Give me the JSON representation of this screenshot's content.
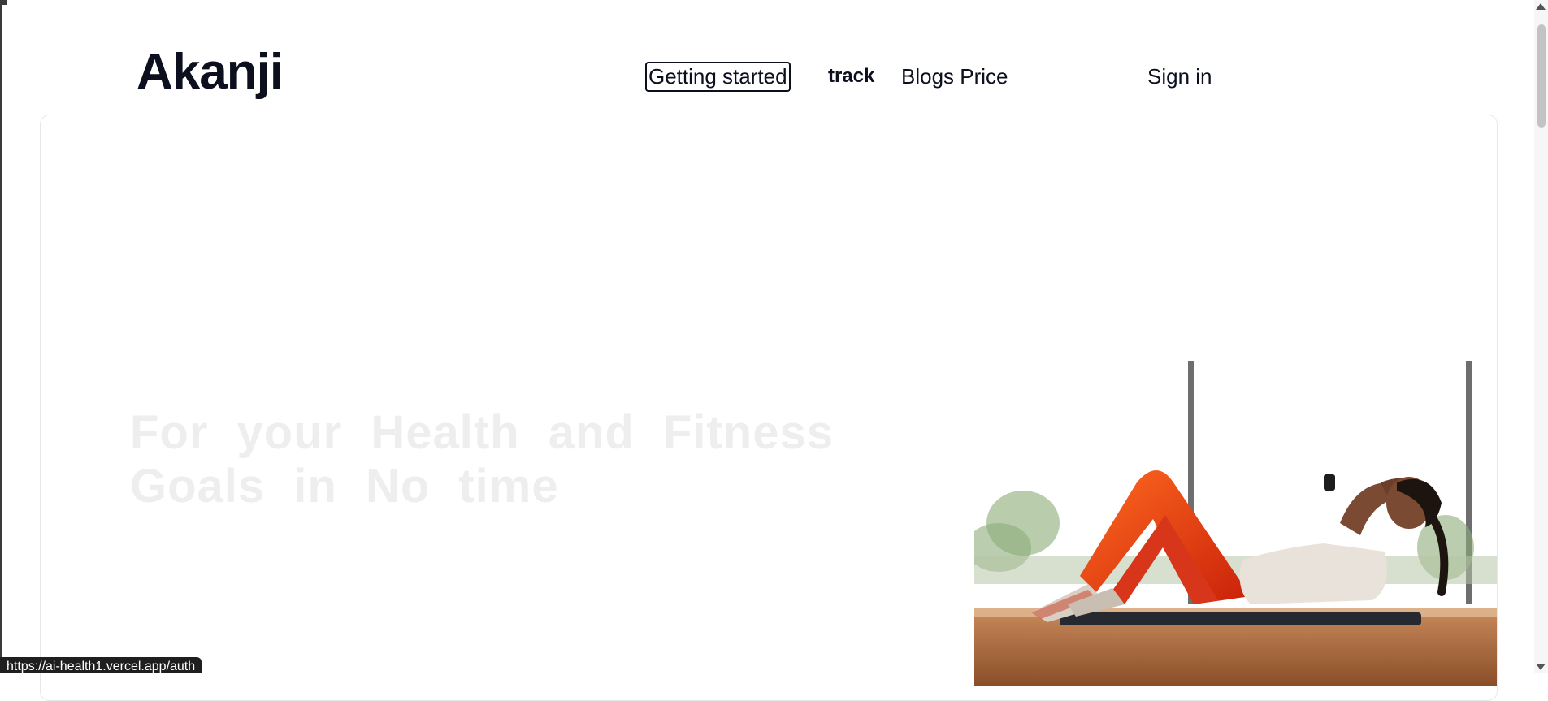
{
  "header": {
    "logo": "Akanji",
    "nav": {
      "getting_started": "Getting started",
      "track": "track",
      "blogs_price": "Blogs Price",
      "sign_in": "Sign in"
    }
  },
  "hero": {
    "heading": "For your Health and Fitness Goals in No time",
    "image_icon": "woman-doing-crunches-photo"
  },
  "status_bar": {
    "url": "https://ai-health1.vercel.app/auth"
  },
  "colors": {
    "text_dark": "#0b0f1e",
    "heading_faint": "#eeeeee",
    "card_border": "#e5e7eb"
  }
}
